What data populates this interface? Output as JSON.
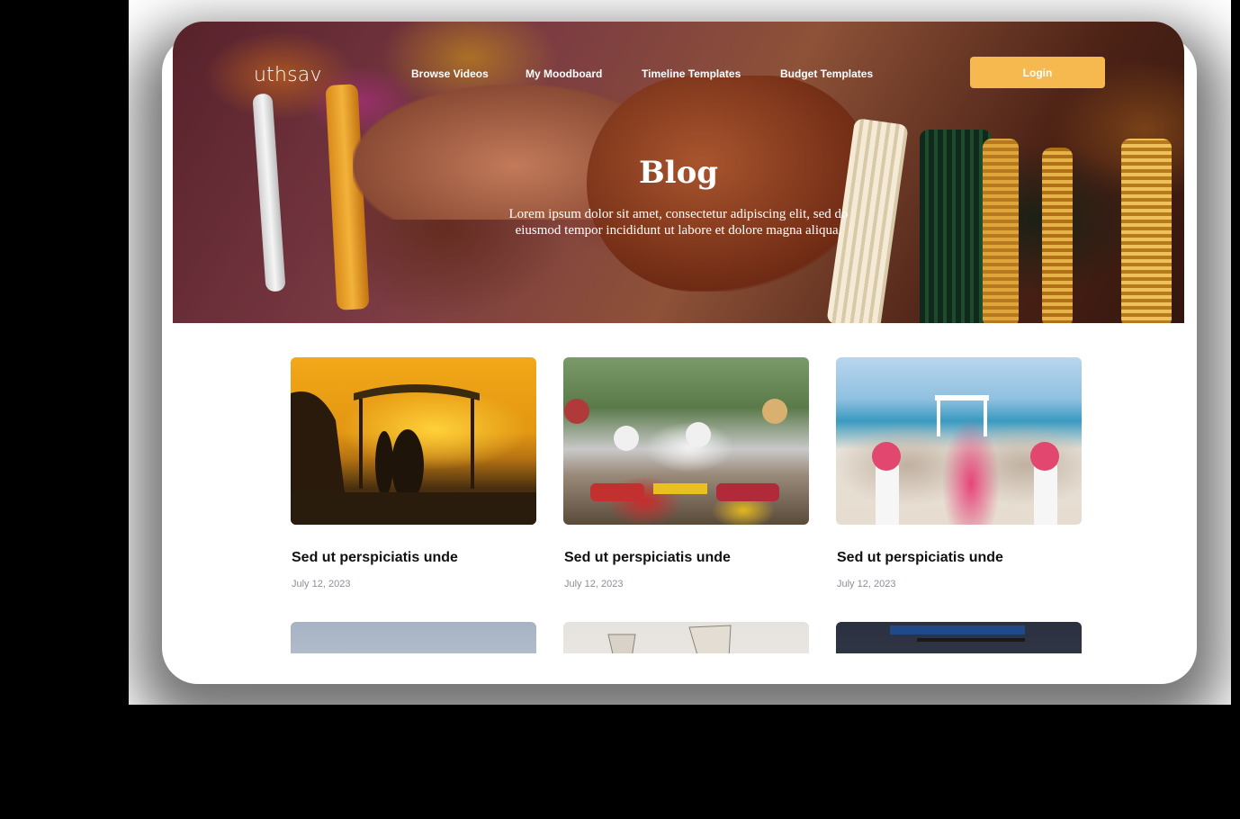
{
  "brand": {
    "logo": "uthsav"
  },
  "nav": {
    "links": [
      "Browse Videos",
      "My Moodboard",
      "Timeline Templates",
      "Budget Templates"
    ],
    "login_label": "Login"
  },
  "hero": {
    "title": "Blog",
    "subtitle": "Lorem ipsum dolor sit amet, consectetur adipiscing elit, sed do eiusmod tempor incididunt ut labore et dolore magna aliqua."
  },
  "posts": [
    {
      "title": "Sed ut perspiciatis unde",
      "date": "July 12, 2023"
    },
    {
      "title": "Sed ut perspiciatis unde",
      "date": "July 12, 2023"
    },
    {
      "title": "Sed ut perspiciatis unde",
      "date": "July 12, 2023"
    }
  ],
  "colors": {
    "accent": "#f5b94f"
  }
}
